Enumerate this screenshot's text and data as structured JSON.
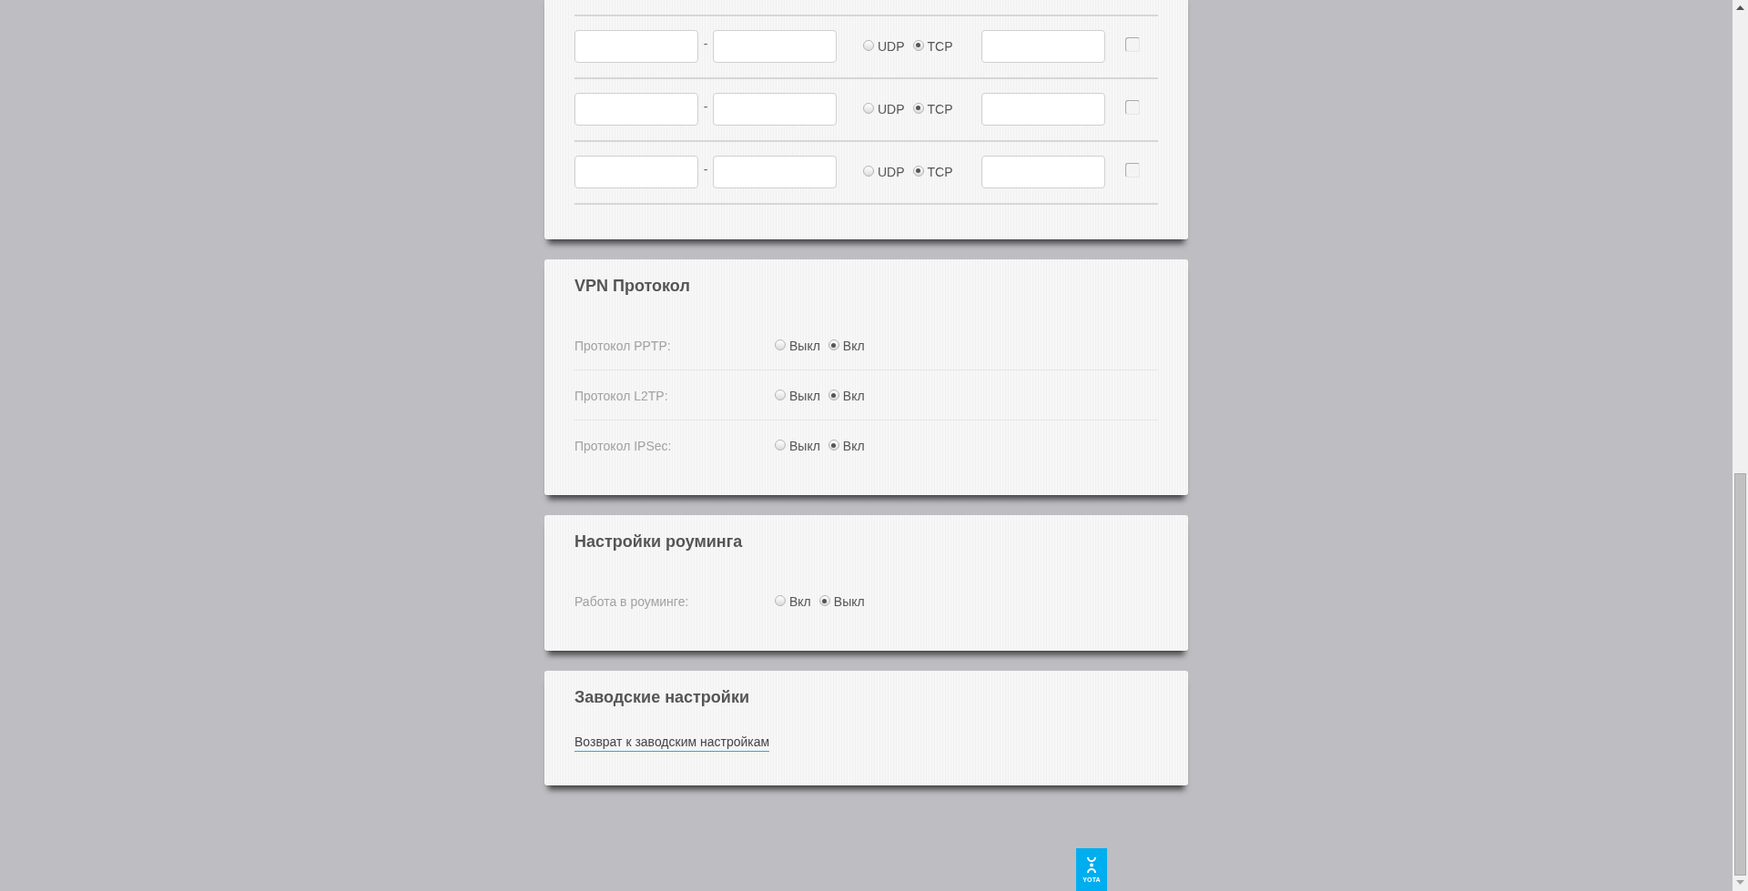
{
  "sections": [
    {
      "kind": "port_table",
      "rows": [
        {
          "range_separator": "-",
          "protocols": [
            {
              "label": "UDP",
              "selected": false
            },
            {
              "label": "TCP",
              "selected": true
            }
          ],
          "checked": false
        },
        {
          "range_separator": "-",
          "protocols": [
            {
              "label": "UDP",
              "selected": false
            },
            {
              "label": "TCP",
              "selected": true
            }
          ],
          "checked": false
        },
        {
          "range_separator": "-",
          "protocols": [
            {
              "label": "UDP",
              "selected": false
            },
            {
              "label": "TCP",
              "selected": true
            }
          ],
          "checked": false
        }
      ]
    },
    {
      "kind": "radio_list",
      "title": "VPN Протокол",
      "rows": [
        {
          "label": "Протокол PPTP:",
          "options": [
            {
              "label": "Выкл",
              "selected": false
            },
            {
              "label": "Вкл",
              "selected": true
            }
          ]
        },
        {
          "label": "Протокол L2TP:",
          "options": [
            {
              "label": "Выкл",
              "selected": false
            },
            {
              "label": "Вкл",
              "selected": true
            }
          ]
        },
        {
          "label": "Протокол IPSec:",
          "options": [
            {
              "label": "Выкл",
              "selected": false
            },
            {
              "label": "Вкл",
              "selected": true
            }
          ]
        }
      ]
    },
    {
      "kind": "radio_list",
      "title": "Настройки роуминга",
      "rows": [
        {
          "label": "Работа в роуминге:",
          "options": [
            {
              "label": "Вкл",
              "selected": false
            },
            {
              "label": "Выкл",
              "selected": true
            }
          ]
        }
      ]
    },
    {
      "kind": "link",
      "title": "Заводские настройки",
      "link": "Возврат к заводским настройкам"
    }
  ],
  "footer": {
    "logo_text": "YOTA"
  }
}
